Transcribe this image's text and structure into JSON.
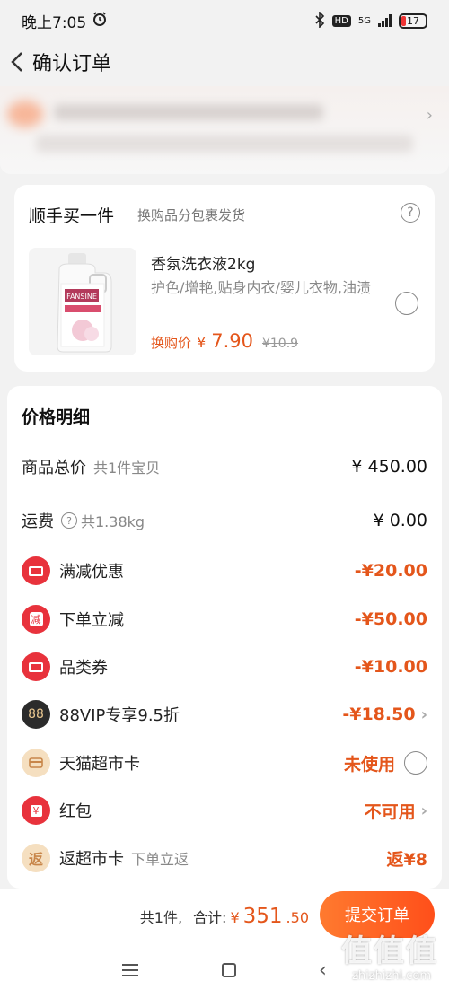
{
  "status_bar": {
    "time": "晚上7:05",
    "network": "5G",
    "hd": "HD",
    "battery": "17"
  },
  "nav": {
    "title": "确认订单"
  },
  "addon": {
    "title": "顺手买一件",
    "subtitle": "换购品分包裹发货",
    "product_name": "香氛洗衣液2kg",
    "product_desc": "护色/增艳,贴身内衣/婴儿衣物,油渍",
    "price_label": "换购价",
    "price_currency": "¥",
    "price_main": "7.90",
    "price_old": "¥10.9",
    "product_brand_text": "FANSINE"
  },
  "price_detail": {
    "title": "价格明细",
    "rows": [
      {
        "label": "商品总价",
        "sub": "共1件宝贝",
        "value": "¥ 450.00"
      },
      {
        "label": "运费",
        "sub": "共1.38kg",
        "value": "¥ 0.00"
      },
      {
        "label": "满减优惠",
        "sub": "",
        "value": "-¥20.00"
      },
      {
        "label": "下单立减",
        "sub": "",
        "value": "-¥50.00",
        "icon_text": "减"
      },
      {
        "label": "品类券",
        "sub": "",
        "value": "-¥10.00"
      },
      {
        "label": "88VIP专享9.5折",
        "sub": "",
        "value": "-¥18.50",
        "icon_text": "88"
      },
      {
        "label": "天猫超市卡",
        "sub": "",
        "value": "未使用"
      },
      {
        "label": "红包",
        "sub": "",
        "value": "不可用",
        "icon_text": "¥"
      },
      {
        "label": "返超市卡",
        "sub": "下单立返",
        "value": "返¥8",
        "icon_text": "返"
      }
    ]
  },
  "bottom": {
    "count": "共1件,",
    "total_label": "合计:",
    "total_currency": "¥",
    "total_main": "351",
    "total_dec": ".50",
    "submit": "提交订单"
  },
  "watermark": {
    "text": "值值值",
    "url": "zhizhizhi.com"
  },
  "colors": {
    "accent": "#e4561b",
    "red_icon": "#e8323c",
    "submit_start": "#ff7a2f",
    "submit_end": "#ff4f1a"
  }
}
